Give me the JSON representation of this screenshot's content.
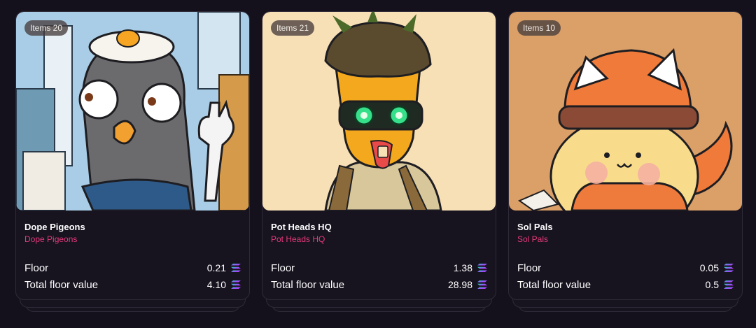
{
  "cards": [
    {
      "items_badge": "Items 20",
      "name": "Dope Pigeons",
      "collection": "Dope Pigeons",
      "floor_label": "Floor",
      "floor_value": "0.21",
      "total_label": "Total floor value",
      "total_value": "4.10",
      "currency_icon": "solana-icon"
    },
    {
      "items_badge": "Items 21",
      "name": "Pot Heads HQ",
      "collection": "Pot Heads HQ",
      "floor_label": "Floor",
      "floor_value": "1.38",
      "total_label": "Total floor value",
      "total_value": "28.98",
      "currency_icon": "solana-icon"
    },
    {
      "items_badge": "Items 10",
      "name": "Sol Pals",
      "collection": "Sol Pals",
      "floor_label": "Floor",
      "floor_value": "0.05",
      "total_label": "Total floor value",
      "total_value": "0.5",
      "currency_icon": "solana-icon"
    }
  ],
  "colors": {
    "background": "#14111c",
    "card": "#17131f",
    "accent_pink": "#e63a7a"
  }
}
